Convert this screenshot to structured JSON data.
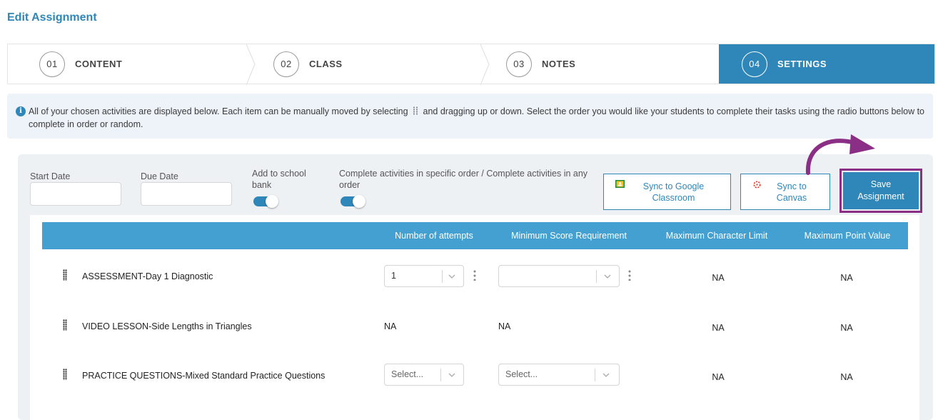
{
  "page": {
    "title": "Edit Assignment"
  },
  "steps": [
    {
      "num": "01",
      "label": "CONTENT",
      "active": false
    },
    {
      "num": "02",
      "label": "CLASS",
      "active": false
    },
    {
      "num": "03",
      "label": "NOTES",
      "active": false
    },
    {
      "num": "04",
      "label": "SETTINGS",
      "active": true
    }
  ],
  "info": {
    "text_before": "All of your chosen activities are displayed below. Each item can be manually moved by selecting",
    "text_after": "and dragging up or down. Select the order you would like your students to complete their tasks using the radio buttons below to complete in order or random."
  },
  "settings": {
    "start_date_label": "Start Date",
    "due_date_label": "Due Date",
    "school_bank_label": "Add to school bank",
    "order_label": "Complete activities in specific order / Complete activities in any order",
    "start_date_value": "",
    "due_date_value": "",
    "school_bank_on": true,
    "order_toggle_on": true
  },
  "actions": {
    "sync_google": "Sync to Google Classroom",
    "sync_canvas": "Sync to Canvas",
    "save": "Save Assignment"
  },
  "table": {
    "headers": [
      "",
      "Number of attempts",
      "Minimum Score Requirement",
      "Maximum Character Limit",
      "Maximum Point Value"
    ],
    "rows": [
      {
        "name": "ASSESSMENT-Day 1 Diagnostic",
        "attempts": "1",
        "min_score": "",
        "max_char": "NA",
        "max_point": "NA"
      },
      {
        "name": "VIDEO LESSON-Side Lengths in Triangles",
        "attempts": "NA",
        "min_score": "NA",
        "max_char": "NA",
        "max_point": "NA"
      },
      {
        "name": "PRACTICE QUESTIONS-Mixed Standard Practice Questions",
        "attempts": "Select...",
        "min_score": "Select...",
        "max_char": "NA",
        "max_point": "NA"
      }
    ]
  },
  "colors": {
    "accent": "#2f86b8",
    "header": "#43a0d0",
    "highlight": "#8b2f86"
  }
}
